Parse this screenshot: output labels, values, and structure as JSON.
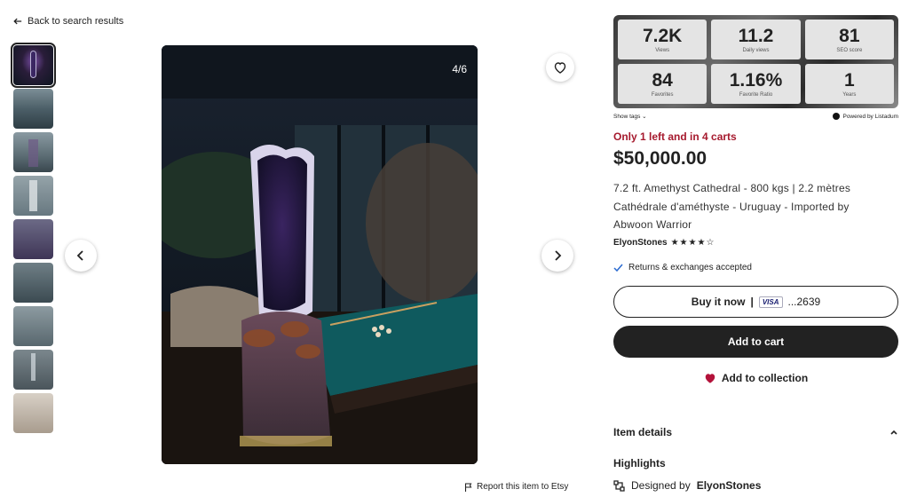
{
  "nav": {
    "back_label": "Back to search results"
  },
  "gallery": {
    "counter": "4/6",
    "thumbnail_count": 9
  },
  "report_label": "Report this item to Etsy",
  "stats": [
    {
      "value": "7.2K",
      "label": "Views"
    },
    {
      "value": "11.2",
      "label": "Daily views"
    },
    {
      "value": "81",
      "label": "SEO score"
    },
    {
      "value": "84",
      "label": "Favorites"
    },
    {
      "value": "1.16%",
      "label": "Favorite Ratio"
    },
    {
      "value": "1",
      "label": "Years"
    }
  ],
  "show_tags_label": "Show tags",
  "powered_by": "Powered by Listadum",
  "listing": {
    "stock_notice": "Only 1 left and in 4 carts",
    "price": "$50,000.00",
    "title": "7.2 ft. Amethyst Cathedral - 800 kgs | 2.2 mètres Cathédrale d'améthyste - Uruguay - Imported by Abwoon Warrior",
    "shop_name": "ElyonStones",
    "rating": 4,
    "returns": "Returns & exchanges accepted"
  },
  "actions": {
    "buy_now": "Buy it now",
    "separator": "|",
    "card_brand": "VISA",
    "card_number": "...2639",
    "add_to_cart": "Add to cart",
    "add_to_collection": "Add to collection"
  },
  "sections": {
    "item_details": "Item details",
    "highlights": "Highlights",
    "designed_by_prefix": "Designed by",
    "designed_by_shop": "ElyonStones"
  },
  "colors": {
    "stock_notice": "#a61a2e",
    "primary_button": "#222222",
    "heart": "#b3123a"
  },
  "icons": {
    "back": "arrow-left-icon",
    "favorite": "heart-outline-icon",
    "prev": "chevron-left-icon",
    "next": "chevron-right-icon",
    "report": "flag-icon",
    "returns": "check-icon",
    "collection": "heart-filled-icon",
    "details_toggle": "chevron-up-icon",
    "designed": "tools-icon"
  }
}
